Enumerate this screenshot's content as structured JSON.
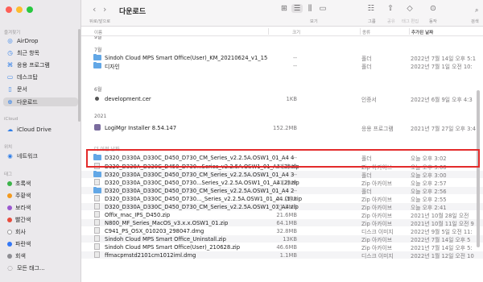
{
  "window": {
    "title": "다운로드"
  },
  "toolbar": {
    "back_label": "‹",
    "forward_label": "›",
    "nav_caption": "뒤로/앞으로",
    "view_caption": "보기",
    "group_caption": "그룹",
    "share_caption": "공유",
    "tag_caption": "태그 편집",
    "action_caption": "동작",
    "search_caption": "검색",
    "view_icons": [
      "icon-view-icon",
      "list-view-icon",
      "column-view-icon",
      "gallery-view-icon"
    ]
  },
  "sidebar": {
    "sections": {
      "favorites": "즐겨찾기",
      "icloud": "iCloud",
      "location": "위치",
      "tags": "태그"
    },
    "favorites": [
      {
        "label": "AirDrop",
        "icon": "airdrop-icon"
      },
      {
        "label": "최근 항목",
        "icon": "clock-icon"
      },
      {
        "label": "응용 프로그램",
        "icon": "apps-icon"
      },
      {
        "label": "데스크탑",
        "icon": "desktop-icon"
      },
      {
        "label": "문서",
        "icon": "doc-icon"
      },
      {
        "label": "다운로드",
        "icon": "download-icon",
        "active": true
      }
    ],
    "icloud": [
      {
        "label": "iCloud Drive",
        "icon": "cloud-icon"
      }
    ],
    "location": [
      {
        "label": "네트워크",
        "icon": "network-icon"
      }
    ],
    "tags": [
      {
        "label": "초록색",
        "color": "#3cb34a"
      },
      {
        "label": "주황색",
        "color": "#f39a1f"
      },
      {
        "label": "보라색",
        "color": "#9b59d0"
      },
      {
        "label": "빨간색",
        "color": "#e84c3d"
      },
      {
        "label": "회사",
        "color": "#ffffff"
      },
      {
        "label": "파란색",
        "color": "#3478f6"
      },
      {
        "label": "회색",
        "color": "#8e8e93"
      },
      {
        "label": "모든 태그...",
        "color": ""
      }
    ]
  },
  "columns": {
    "name": "이름",
    "size": "크기",
    "kind": "종류",
    "date_added": "추가된 날짜"
  },
  "groups": {
    "g0": "9월",
    "g1": "7월",
    "g2": "6월",
    "g3": "2021",
    "g4": "더 이전 날짜"
  },
  "files": [
    {
      "name": "Sindoh Cloud MPS Smart Office(User)_KM_20210624_v1_15",
      "size": "--",
      "kind": "폴더",
      "date": "2022년 7월 14일 오후 5:1",
      "icon": "folder-icon"
    },
    {
      "name": "디자인",
      "size": "--",
      "kind": "폴더",
      "date": "2022년 7월 1일 오전 10:",
      "icon": "folder-icon"
    },
    {
      "name": "development.cer",
      "size": "1KB",
      "kind": "인증서",
      "date": "2022년 6월 9일 오후 4:3",
      "icon": "certificate-icon"
    },
    {
      "name": "LogiMgr Installer 8.54.147",
      "size": "152.2MB",
      "kind": "응용 프로그램",
      "date": "2021년 7월 27일 오후 3:4",
      "icon": "app-icon"
    },
    {
      "name": "D320_D330A_D330C_D450_D730_CM_Series_v2.2.5A.OSW1_01_A4 4",
      "size": "--",
      "kind": "폴더",
      "date": "오늘 오후 3:02",
      "icon": "folder-icon"
    },
    {
      "name": "D320_D330A_D330C_D450_D730...Series_v2.2.5A.OSW1_01_A4 (3).zip",
      "size": "21.2MB",
      "kind": "Zip 아카이브",
      "date": "오늘 오후 3:00",
      "icon": "zip-icon"
    },
    {
      "name": "D320_D330A_D330C_D450_D730_CM_Series_v2.2.5A.OSW1_01_A4 3",
      "size": "--",
      "kind": "폴더",
      "date": "오늘 오후 3:00",
      "icon": "folder-icon"
    },
    {
      "name": "D320_D330A_D330C_D450_D730...Series_v2.2.5A.OSW1_01_A4 (2).zip",
      "size": "21.2MB",
      "kind": "Zip 아카이브",
      "date": "오늘 오후 2:57",
      "icon": "zip-icon"
    },
    {
      "name": "D320_D330A_D330C_D450_D730_CM_Series_v2.2.5A.OSW1_01_A4 2",
      "size": "--",
      "kind": "폴더",
      "date": "오늘 오후 2:56",
      "icon": "folder-icon"
    },
    {
      "name": "D320_D330A_D330C_D450_D730..._Series_v2.2.5A.OSW1_01_A4 (1).zip",
      "size": "21.2MB",
      "kind": "Zip 아카이브",
      "date": "오늘 오후 2:55",
      "icon": "zip-icon"
    },
    {
      "name": "D320_D330A_D330C_D450_D730_CM_Series_v2.2.5A.OSW1_01_A4.zip",
      "size": "21.2MB",
      "kind": "Zip 아카이브",
      "date": "오늘 오후 2:41",
      "icon": "zip-icon"
    },
    {
      "name": "Offix_mac_IPS_D450.zip",
      "size": "21.6MB",
      "kind": "Zip 아카이브",
      "date": "2021년 10월 28일 오전 ",
      "icon": "zip-icon"
    },
    {
      "name": "N800_MF_Series_MacOS_v3.x.x.OSW1_01.zip",
      "size": "64.1MB",
      "kind": "Zip 아카이브",
      "date": "2021년 10월 11일 오전 9",
      "icon": "zip-icon"
    },
    {
      "name": "C941_PS_OSX_010203_298047.dmg",
      "size": "32.8MB",
      "kind": "디스크 이미지",
      "date": "2022년 9월 5일 오전 11:",
      "icon": "disk-image-icon"
    },
    {
      "name": "Sindoh Cloud MPS Smart Office_Uninstall.zip",
      "size": "13KB",
      "kind": "Zip 아카이브",
      "date": "2022년 7월 14일 오후 5",
      "icon": "zip-icon"
    },
    {
      "name": "Sindoh Cloud MPS Smart Office(User)_210628.zip",
      "size": "46.6MB",
      "kind": "Zip 아카이브",
      "date": "2021년 7월 14일 오후 5:",
      "icon": "zip-icon"
    },
    {
      "name": "ffmacpmstd2101cm1012iml.dmg",
      "size": "1.1MB",
      "kind": "디스크 이미지",
      "date": "2022년 1월 12일 오전 10",
      "icon": "disk-image-icon"
    }
  ]
}
